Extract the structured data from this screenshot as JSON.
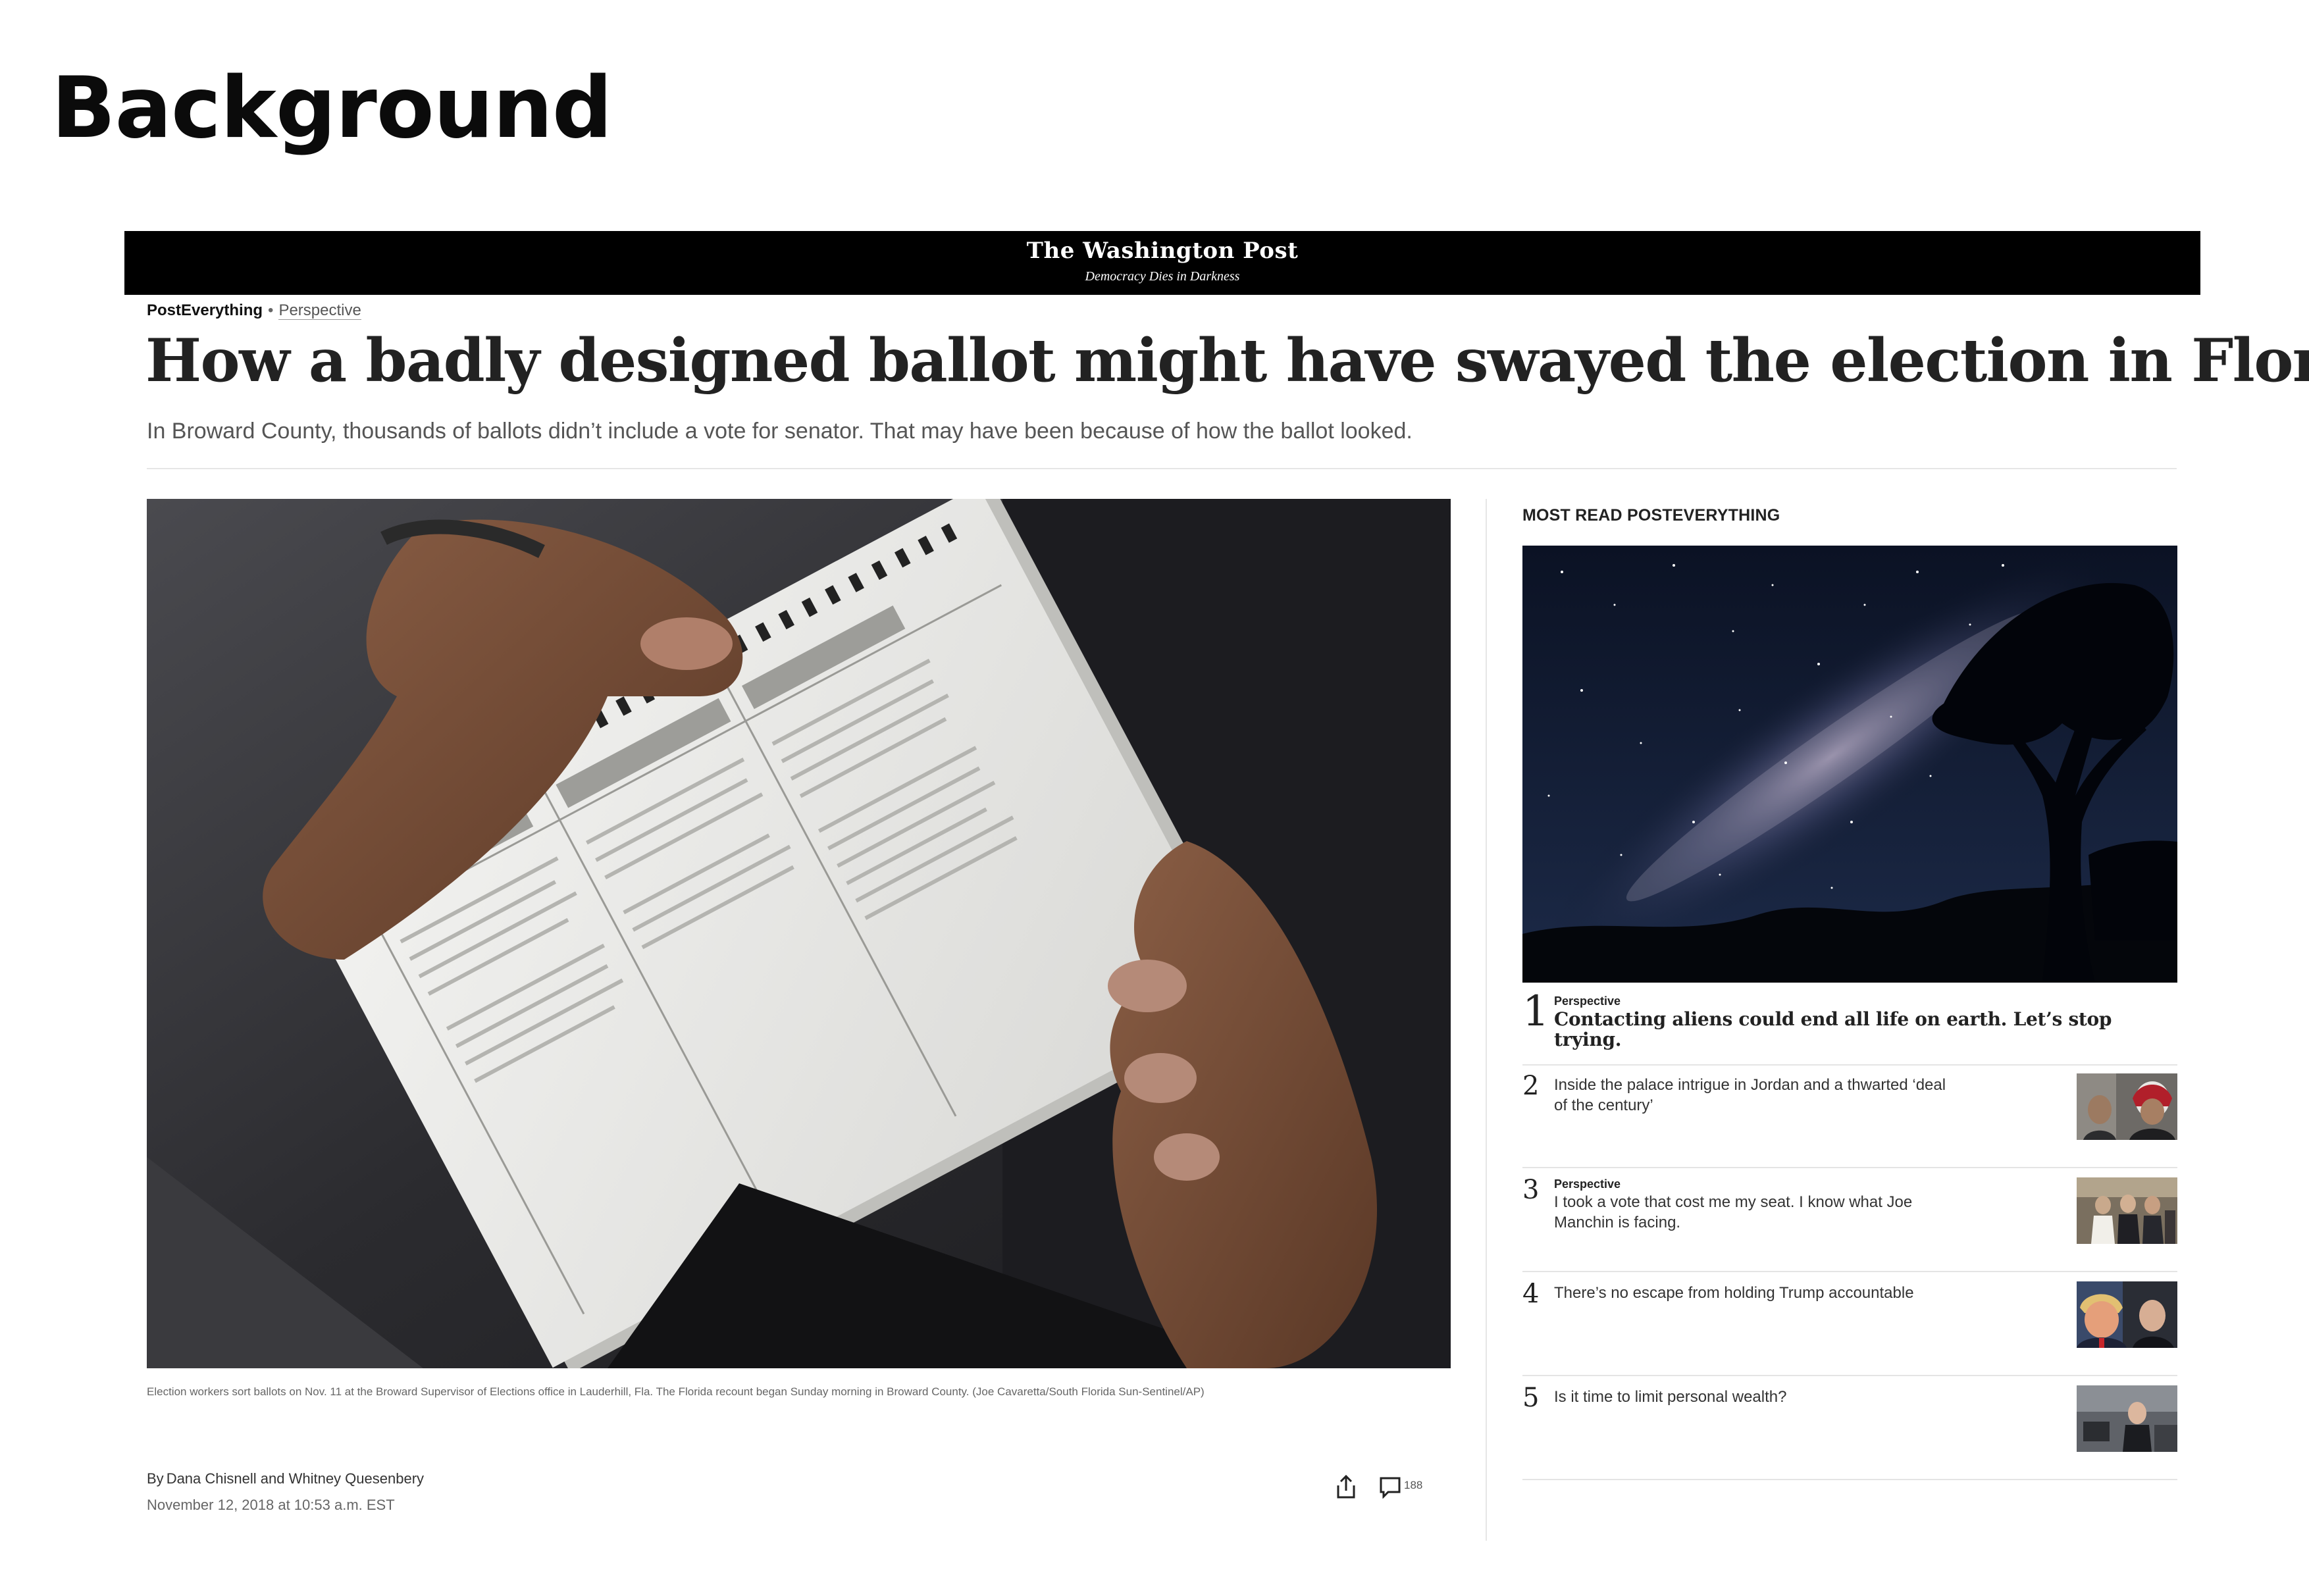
{
  "slide": {
    "title": "Background"
  },
  "page": {
    "masthead": "The Washington Post",
    "tagline": "Democracy Dies in Darkness",
    "kicker": {
      "section": "PostEverything",
      "separator": "•",
      "label": "Perspective"
    },
    "headline": "How a badly designed ballot might have swayed the election in Florida",
    "dek": "In Broward County, thousands of ballots didn’t include a vote for senator. That may have been because of how the ballot looked.",
    "caption": "Election workers sort ballots on Nov. 11 at the Broward Supervisor of Elections office in Lauderhill, Fla. The Florida recount began Sunday morning in Broward County. (Joe Cavaretta/South Florida Sun-Sentinel/AP)",
    "byline": {
      "prefix": "By",
      "authors": "Dana Chisnell and Whitney Quesenbery"
    },
    "date": "November 12, 2018 at 10:53 a.m. EST",
    "comment_count": "188",
    "icons": {
      "share": "share-icon",
      "comments": "comment-icon"
    }
  },
  "sidebar": {
    "title": "MOST READ POSTEVERYTHING",
    "items": [
      {
        "num": "1",
        "tag": "Perspective",
        "text": "Contacting aliens could end all life on earth. Let’s stop trying."
      },
      {
        "num": "2",
        "tag": "",
        "text": "Inside the palace intrigue in Jordan and a thwarted ‘deal of the century’"
      },
      {
        "num": "3",
        "tag": "Perspective",
        "text": "I took a vote that cost me my seat. I know what Joe Manchin is facing."
      },
      {
        "num": "4",
        "tag": "",
        "text": "There’s no escape from holding Trump accountable"
      },
      {
        "num": "5",
        "tag": "",
        "text": "Is it time to limit personal wealth?"
      }
    ]
  },
  "colors": {
    "masthead_bg": "#000000",
    "text_dark": "#222222",
    "text_muted": "#666666",
    "rule": "#e6e6e6"
  }
}
